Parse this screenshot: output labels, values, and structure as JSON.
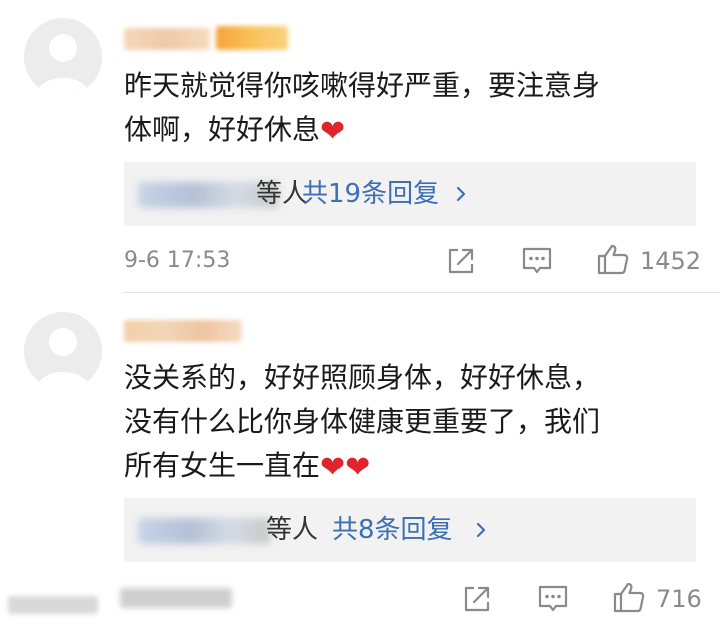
{
  "comments": [
    {
      "text_lines": [
        "昨天就觉得你咳嗽得好严重，要注意身",
        "体啊，好好休息"
      ],
      "hearts": [
        "❤"
      ],
      "reply_suffix": "等人",
      "reply_link": "共19条回复",
      "time": "9-6 17:53",
      "likes": "1452"
    },
    {
      "text_lines": [
        "没关系的，好好照顾身体，好好休息，",
        "没有什么比你身体健康更重要了，我们",
        "所有女生一直在"
      ],
      "hearts": [
        "❤",
        "❤"
      ],
      "reply_suffix": "等人",
      "reply_link": "共8条回复",
      "time": "",
      "likes": "716"
    }
  ],
  "icons": {
    "share": "share-icon",
    "comment": "comment-icon",
    "like": "thumbs-up-icon",
    "chevron": "chevron-right-icon"
  },
  "colors": {
    "link": "#3d6fb5",
    "heart": "#e0242c",
    "meta": "#8a8a8a",
    "reply_bg": "#f2f2f2"
  }
}
